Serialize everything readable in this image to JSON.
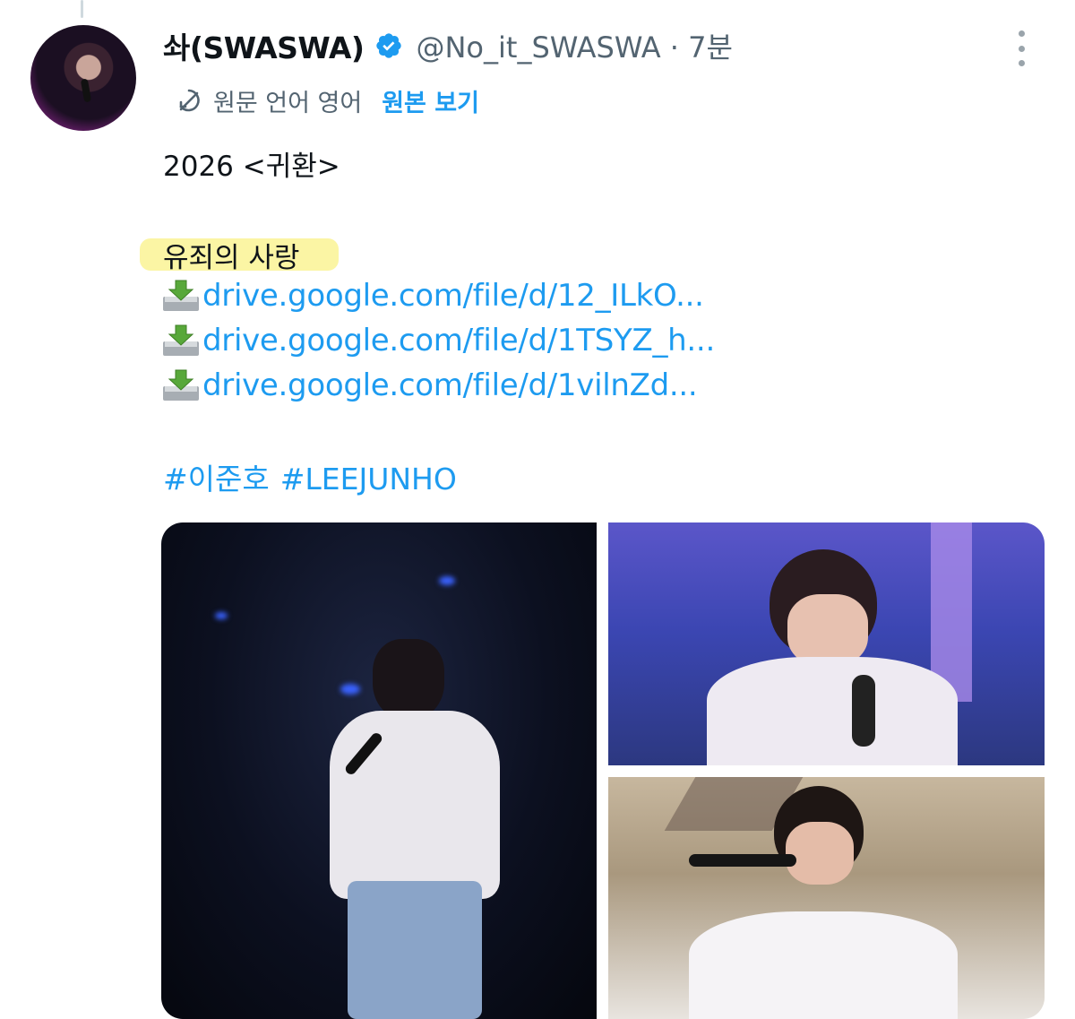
{
  "tweet": {
    "display_name": "솨(SWASWA)",
    "handle_time": "@No_it_SWASWA · 7분",
    "translate": {
      "language_note": "원문 언어 영어",
      "view_original": "원본 보기"
    },
    "text": {
      "line1": "2026 <귀환>",
      "song_title": "유죄의 사랑"
    },
    "links": [
      "drive.google.com/file/d/12_ILkO...",
      "drive.google.com/file/d/1TSYZ_h...",
      "drive.google.com/file/d/1vilnZd..."
    ],
    "hashtags": [
      "#이준호",
      "#LEEJUNHO"
    ]
  },
  "colors": {
    "accent": "#1d9bf0",
    "secondary_text": "#536471",
    "highlight": "#fbf49a",
    "verified": "#1d9bf0"
  },
  "icons": {
    "verified": "verified-badge-icon",
    "translate": "translate-icon",
    "more": "more-options-icon",
    "download": "inbox-tray-download-icon"
  },
  "media": {
    "count": 3
  }
}
